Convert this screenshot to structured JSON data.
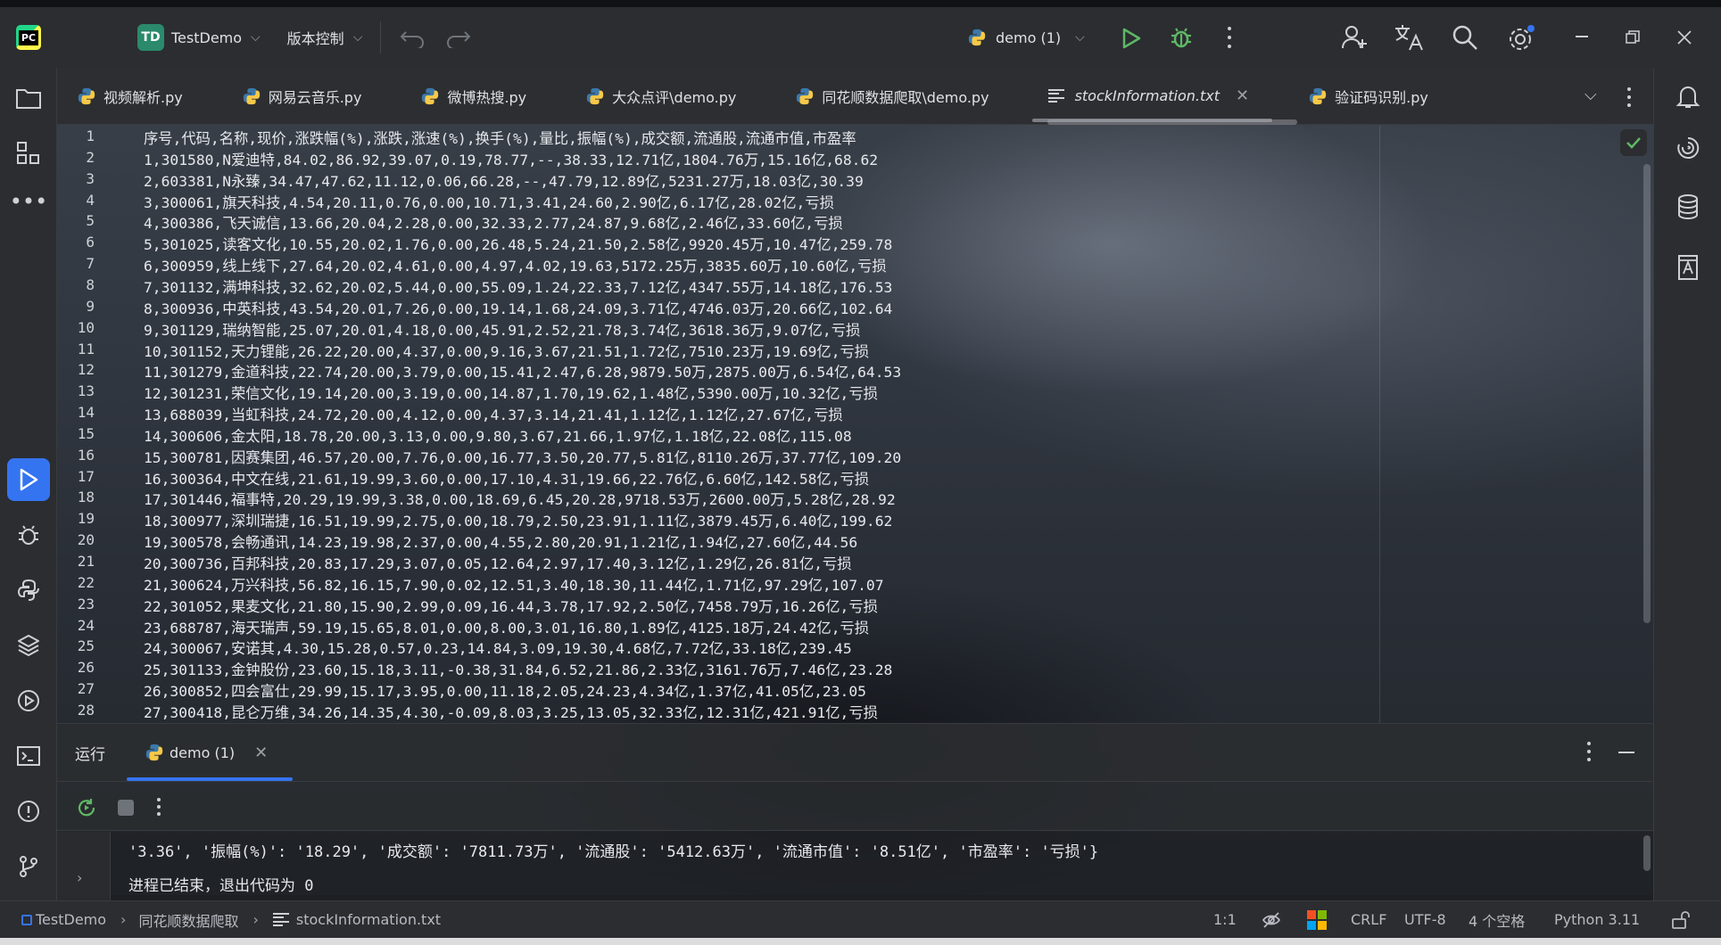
{
  "topbar": {
    "project_badge": "TD",
    "project_name": "TestDemo",
    "vcs_label": "版本控制",
    "run_config": "demo (1)"
  },
  "tabs": [
    {
      "label": "视频解析.py",
      "icon": "python-icon"
    },
    {
      "label": "网易云音乐.py",
      "icon": "python-icon"
    },
    {
      "label": "微博热搜.py",
      "icon": "python-icon"
    },
    {
      "label": "大众点评\\demo.py",
      "icon": "python-icon"
    },
    {
      "label": "同花顺数据爬取\\demo.py",
      "icon": "python-icon"
    },
    {
      "label": "stockInformation.txt",
      "icon": "text-file-icon",
      "active": true
    },
    {
      "label": "验证码识别.py",
      "icon": "python-icon"
    }
  ],
  "editor": {
    "line_numbers": [
      "1",
      "2",
      "3",
      "4",
      "5",
      "6",
      "7",
      "8",
      "9",
      "10",
      "11",
      "12",
      "13",
      "14",
      "15",
      "16",
      "17",
      "18",
      "19",
      "20",
      "21",
      "22",
      "23",
      "24",
      "25",
      "26",
      "27",
      "28"
    ],
    "lines": [
      "序号,代码,名称,现价,涨跌幅(%),涨跌,涨速(%),换手(%),量比,振幅(%),成交额,流通股,流通市值,市盈率",
      "1,301580,N爱迪特,84.02,86.92,39.07,0.19,78.77,--,38.33,12.71亿,1804.76万,15.16亿,68.62",
      "2,603381,N永臻,34.47,47.62,11.12,0.06,66.28,--,47.79,12.89亿,5231.27万,18.03亿,30.39",
      "3,300061,旗天科技,4.54,20.11,0.76,0.00,10.71,3.41,24.60,2.90亿,6.17亿,28.02亿,亏损",
      "4,300386,飞天诚信,13.66,20.04,2.28,0.00,32.33,2.77,24.87,9.68亿,2.46亿,33.60亿,亏损",
      "5,301025,读客文化,10.55,20.02,1.76,0.00,26.48,5.24,21.50,2.58亿,9920.45万,10.47亿,259.78",
      "6,300959,线上线下,27.64,20.02,4.61,0.00,4.97,4.02,19.63,5172.25万,3835.60万,10.60亿,亏损",
      "7,301132,满坤科技,32.62,20.02,5.44,0.00,55.09,1.24,22.33,7.12亿,4347.55万,14.18亿,176.53",
      "8,300936,中英科技,43.54,20.01,7.26,0.00,19.14,1.68,24.09,3.71亿,4746.03万,20.66亿,102.64",
      "9,301129,瑞纳智能,25.07,20.01,4.18,0.00,45.91,2.52,21.78,3.74亿,3618.36万,9.07亿,亏损",
      "10,301152,天力锂能,26.22,20.00,4.37,0.00,9.16,3.67,21.51,1.72亿,7510.23万,19.69亿,亏损",
      "11,301279,金道科技,22.74,20.00,3.79,0.00,15.41,2.47,6.28,9879.50万,2875.00万,6.54亿,64.53",
      "12,301231,荣信文化,19.14,20.00,3.19,0.00,14.87,1.70,19.62,1.48亿,5390.00万,10.32亿,亏损",
      "13,688039,当虹科技,24.72,20.00,4.12,0.00,4.37,3.14,21.41,1.12亿,1.12亿,27.67亿,亏损",
      "14,300606,金太阳,18.78,20.00,3.13,0.00,9.80,3.67,21.66,1.97亿,1.18亿,22.08亿,115.08",
      "15,300781,因赛集团,46.57,20.00,7.76,0.00,16.77,3.50,20.77,5.81亿,8110.26万,37.77亿,109.20",
      "16,300364,中文在线,21.61,19.99,3.60,0.00,17.10,4.31,19.66,22.76亿,6.60亿,142.58亿,亏损",
      "17,301446,福事特,20.29,19.99,3.38,0.00,18.69,6.45,20.28,9718.53万,2600.00万,5.28亿,28.92",
      "18,300977,深圳瑞捷,16.51,19.99,2.75,0.00,18.79,2.50,23.91,1.11亿,3879.45万,6.40亿,199.62",
      "19,300578,会畅通讯,14.23,19.98,2.37,0.00,4.55,2.80,20.91,1.21亿,1.94亿,27.60亿,44.56",
      "20,300736,百邦科技,20.83,17.29,3.07,0.05,12.64,2.97,17.40,3.12亿,1.29亿,26.81亿,亏损",
      "21,300624,万兴科技,56.82,16.15,7.90,0.02,12.51,3.40,18.30,11.44亿,1.71亿,97.29亿,107.07",
      "22,301052,果麦文化,21.80,15.90,2.99,0.09,16.44,3.78,17.92,2.50亿,7458.79万,16.26亿,亏损",
      "23,688787,海天瑞声,59.19,15.65,8.01,0.00,8.00,3.01,16.80,1.89亿,4125.18万,24.42亿,亏损",
      "24,300067,安诺其,4.30,15.28,0.57,0.23,14.84,3.09,19.30,4.68亿,7.72亿,33.18亿,239.45",
      "25,301133,金钟股份,23.60,15.18,3.11,-0.38,31.84,6.52,21.86,2.33亿,3161.76万,7.46亿,23.28",
      "26,300852,四会富仕,29.99,15.17,3.95,0.00,11.18,2.05,24.23,4.34亿,1.37亿,41.05亿,23.05",
      "27,300418,昆仑万维,34.26,14.35,4.30,-0.09,8.03,3.25,13.05,32.33亿,12.31亿,421.91亿,亏损"
    ]
  },
  "run_panel": {
    "title": "运行",
    "tab_label": "demo (1)",
    "console_lines": [
      "'3.36', '振幅(%)': '18.29', '成交额': '7811.73万', '流通股': '5412.63万', '流通市值': '8.51亿', '市盈率': '亏损'}",
      "进程已结束，退出代码为 0"
    ]
  },
  "statusbar": {
    "project": "TestDemo",
    "folder": "同花顺数据爬取",
    "file": "stockInformation.txt",
    "position": "1:1",
    "line_ending": "CRLF",
    "encoding": "UTF-8",
    "indent": "4 个空格",
    "interpreter": "Python 3.11"
  }
}
